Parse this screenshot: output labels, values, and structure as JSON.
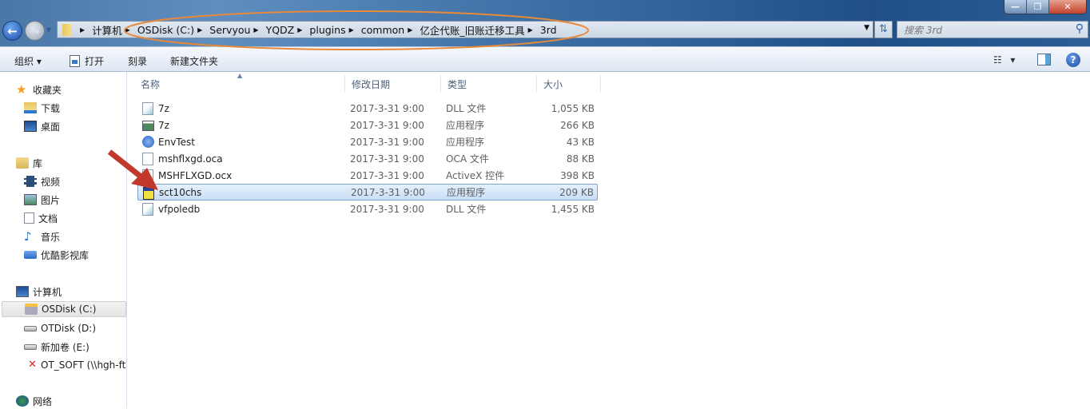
{
  "address_bar": {
    "crumbs": [
      "计算机",
      "OSDisk (C:)",
      "Servyou",
      "YQDZ",
      "plugins",
      "common",
      "亿企代账_旧账迁移工具",
      "3rd"
    ]
  },
  "search": {
    "placeholder": "搜索 3rd"
  },
  "toolbar": {
    "organize": "组织 ▾",
    "open": "打开",
    "burn": "刻录",
    "new_folder": "新建文件夹"
  },
  "sidebar": {
    "favorites": {
      "label": "收藏夹",
      "items": [
        "下载",
        "桌面"
      ]
    },
    "libraries": {
      "label": "库",
      "items": [
        "视频",
        "图片",
        "文档",
        "音乐",
        "优酷影视库"
      ]
    },
    "computer": {
      "label": "计算机",
      "items": [
        "OSDisk (C:)",
        "OTDisk (D:)",
        "新加卷 (E:)",
        "OT_SOFT (\\\\hgh-ft"
      ]
    },
    "network": {
      "label": "网络"
    }
  },
  "columns": {
    "name": "名称",
    "date": "修改日期",
    "type": "类型",
    "size": "大小"
  },
  "files": [
    {
      "name": "7z",
      "date": "2017-3-31 9:00",
      "type": "DLL 文件",
      "size": "1,055 KB",
      "icon": "dll-file-icon"
    },
    {
      "name": "7z",
      "date": "2017-3-31 9:00",
      "type": "应用程序",
      "size": "266 KB",
      "icon": "app-window-icon"
    },
    {
      "name": "EnvTest",
      "date": "2017-3-31 9:00",
      "type": "应用程序",
      "size": "43 KB",
      "icon": "envtest-app-icon"
    },
    {
      "name": "mshflxgd.oca",
      "date": "2017-3-31 9:00",
      "type": "OCA 文件",
      "size": "88 KB",
      "icon": "blank-file-icon"
    },
    {
      "name": "MSHFLXGD.ocx",
      "date": "2017-3-31 9:00",
      "type": "ActiveX 控件",
      "size": "398 KB",
      "icon": "activex-file-icon"
    },
    {
      "name": "sct10chs",
      "date": "2017-3-31 9:00",
      "type": "应用程序",
      "size": "209 KB",
      "icon": "installer-app-icon",
      "selected": true
    },
    {
      "name": "vfpoledb",
      "date": "2017-3-31 9:00",
      "type": "DLL 文件",
      "size": "1,455 KB",
      "icon": "dll-file-icon"
    }
  ],
  "colors": {
    "annotation_ellipse": "#e8893a",
    "annotation_arrow": "#c0392b",
    "selection": "#cde2f8"
  }
}
